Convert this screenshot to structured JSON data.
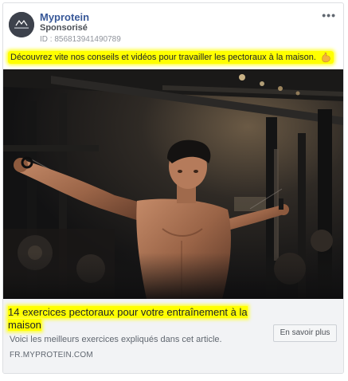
{
  "post": {
    "page_name": "Myprotein",
    "sponsored_label": "Sponsorisé",
    "ad_id": "ID : 856813941490789",
    "more_menu": "•••",
    "text": "Découvrez vite nos conseils et vidéos pour travailler les pectoraux à la maison.",
    "emoji": "flexed-biceps",
    "avatar_brand": "MYPROTEIN"
  },
  "link_preview": {
    "headline": "14 exercices pectoraux pour votre entraînement à la maison",
    "description": "Voici les meilleurs exercices expliqués dans cet article.",
    "domain": "FR.MYPROTEIN.COM",
    "cta_label": "En savoir plus"
  },
  "colors": {
    "page_name": "#385898",
    "highlight": "#ffff00",
    "link_area_bg": "#f2f3f5"
  }
}
